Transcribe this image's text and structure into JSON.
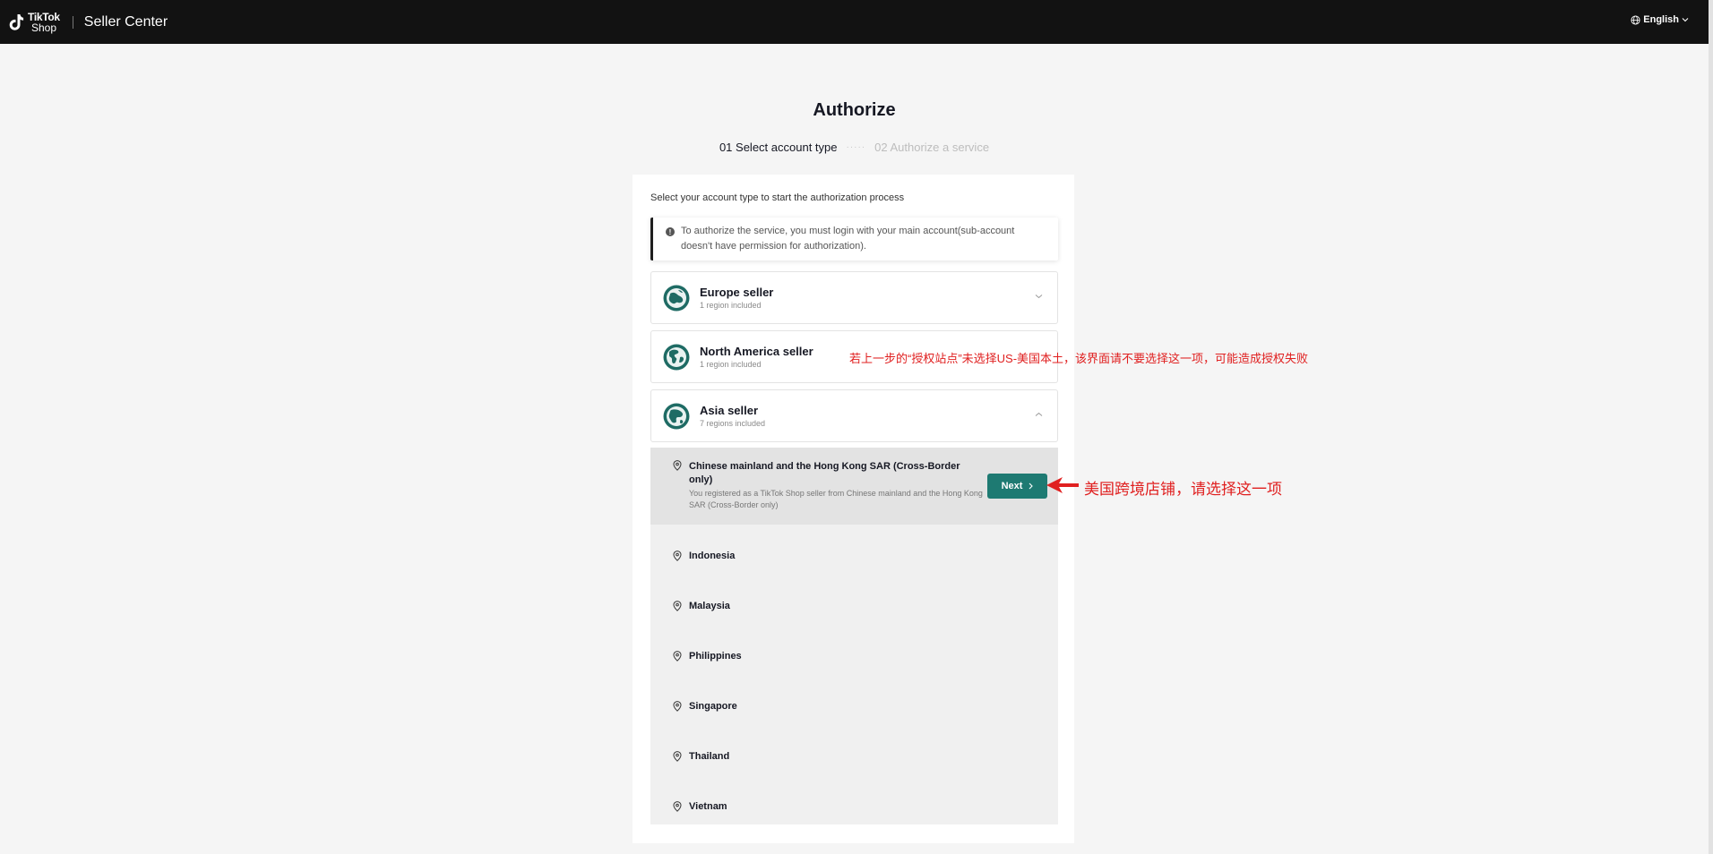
{
  "header": {
    "logo_line1": "TikTok",
    "logo_line2": "Shop",
    "app_title": "Seller Center",
    "language": "English"
  },
  "page": {
    "title": "Authorize",
    "steps": [
      {
        "label": "01 Select account type",
        "active": true
      },
      {
        "label": "02 Authorize a service",
        "active": false
      }
    ]
  },
  "card": {
    "intro": "Select your account type to start the authorization process",
    "notice_line1": "To authorize the service, you must login with your main account(sub-account",
    "notice_line2": "doesn't have permission for authorization)."
  },
  "sellers": [
    {
      "name": "Europe seller",
      "sub": "1 region included",
      "expanded": false
    },
    {
      "name": "North America seller",
      "sub": "1 region included",
      "expanded": false
    },
    {
      "name": "Asia seller",
      "sub": "7 regions included",
      "expanded": true
    }
  ],
  "regions": {
    "selected": {
      "title": "Chinese mainland and the Hong Kong SAR (Cross-Border only)",
      "description": "You registered as a TikTok Shop seller from Chinese mainland and the Hong Kong SAR (Cross-Border only)",
      "button_label": "Next"
    },
    "items": [
      "Indonesia",
      "Malaysia",
      "Philippines",
      "Singapore",
      "Thailand",
      "Vietnam"
    ]
  },
  "annotations": {
    "north_america_note": "若上一步的“授权站点”未选择US-美国本土，该界面请不要选择这一项，可能造成授权失败",
    "cross_border_note": "美国跨境店铺，请选择这一项"
  },
  "colors": {
    "topbar": "#121212",
    "accent": "#1e7a72",
    "annotation": "#e02020",
    "globe": "#1e6b64"
  }
}
